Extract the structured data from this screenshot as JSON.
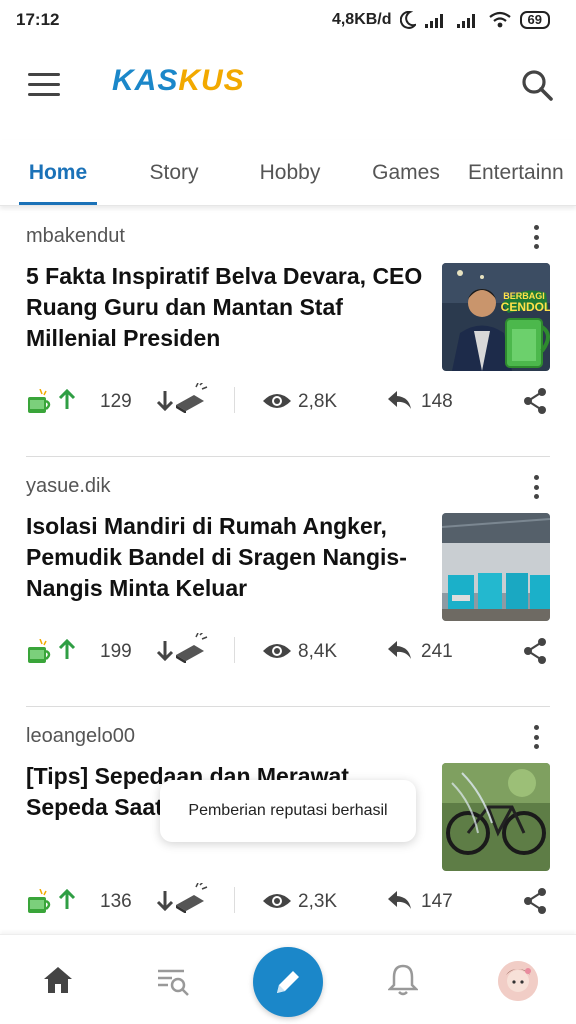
{
  "status_bar": {
    "time": "17:12",
    "network_speed": "4,8KB/d",
    "battery": "69"
  },
  "header": {
    "logo_part1": "KAS",
    "logo_part2": "KUS",
    "brand_blue": "#1b87c9",
    "brand_orange": "#f2a900"
  },
  "tabs": [
    {
      "label": "Home",
      "active": true
    },
    {
      "label": "Story",
      "active": false
    },
    {
      "label": "Hobby",
      "active": false
    },
    {
      "label": "Games",
      "active": false
    },
    {
      "label": "Entertainn",
      "active": false
    }
  ],
  "posts": [
    {
      "author": "mbakendut",
      "title": "5 Fakta Inspiratif Belva Devara, CEO Ruang Guru dan Mantan Staf Millenial Presiden",
      "thumbnail_badge_line1": "BERBAGI",
      "thumbnail_badge_line2": "CENDOL",
      "votes": "129",
      "views": "2,8K",
      "replies": "148"
    },
    {
      "author": "yasue.dik",
      "title": "Isolasi Mandiri di Rumah Angker, Pemudik Bandel di Sragen Nangis-Nangis Minta Keluar",
      "votes": "199",
      "views": "8,4K",
      "replies": "241"
    },
    {
      "author": "leoangelo00",
      "title": "[Tips] Sepedaan dan Merawat Sepeda Saat karena Corona",
      "votes": "136",
      "views": "2,3K",
      "replies": "147"
    }
  ],
  "toast": {
    "message": "Pemberian reputasi berhasil"
  },
  "bottom_nav": {
    "items": [
      "home-icon",
      "feed-search-icon",
      "create-thread-button",
      "notification-bell-icon",
      "profile-avatar"
    ]
  }
}
